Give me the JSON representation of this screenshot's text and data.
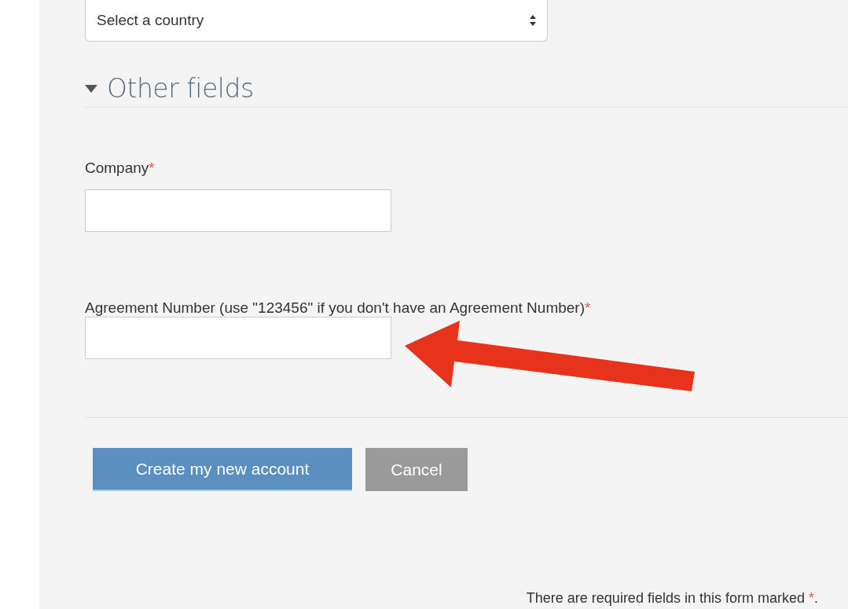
{
  "country_select": {
    "value": "Select a country"
  },
  "section": {
    "title": "Other fields",
    "expanded": true
  },
  "fields": [
    {
      "label": "Company",
      "required_mark": "*"
    },
    {
      "label": "Agreement Number (use \"123456\" if you don't have an Agreement Number)",
      "required_mark": "*"
    }
  ],
  "buttons": [
    {
      "label": "Create my new account",
      "kind": "primary"
    },
    {
      "label": "Cancel",
      "kind": "secondary"
    }
  ],
  "footer_note": {
    "text": "There are required fields in this form marked ",
    "mark": "*",
    "end": "."
  }
}
